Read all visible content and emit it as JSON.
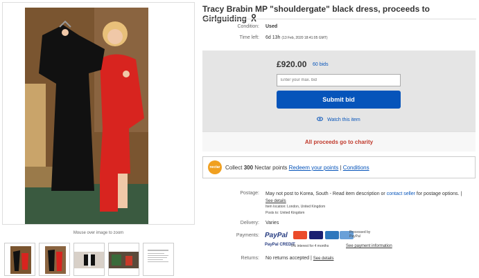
{
  "listing": {
    "title": "Tracy Brabin MP \"shouldergate\" black dress, proceeds to Girlguiding",
    "condition_label": "Condition:",
    "condition_value": "Used",
    "time_left_label": "Time left:",
    "time_left_value": "6d 13h",
    "time_left_detail": "(13 Feb, 2020  18:41:05 GMT)"
  },
  "gallery": {
    "zoom_hint": "Mouse over image to zoom",
    "thumbnail_count": 5
  },
  "bidding": {
    "price": "£920.00",
    "bids": "60 bids",
    "bid_placeholder": "Enter your max. bid",
    "submit_label": "Submit bid",
    "watch_label": "Watch this item",
    "charity_text": "All proceeds go to charity"
  },
  "nectar": {
    "logo": "nectar",
    "collect_prefix": "Collect",
    "points": "300",
    "points_suffix": "Nectar points",
    "redeem_link": "Redeem your points",
    "separator": "|",
    "conditions_link": "Conditions"
  },
  "details": {
    "postage_label": "Postage:",
    "postage_value": "May not post to Korea, South - Read item description or",
    "contact_link": "contact seller",
    "postage_suffix": "for",
    "postage_line2": "postage options.",
    "see_details": "See details",
    "item_location": "Item location:  London, United Kingdom",
    "posts_to": "Posts to:  United Kingdom",
    "delivery_label": "Delivery:",
    "delivery_value": "Varies",
    "payments_label": "Payments:",
    "paypal_label": "PayPal",
    "processed_by": "Processed by PayPal",
    "paypal_credit": "PayPal CREDIT",
    "credit_text": "0% interest for 4 months",
    "see_payment_info": "See payment information",
    "returns_label": "Returns:",
    "returns_value": "No returns accepted",
    "returns_see_details": "See details"
  },
  "colors": {
    "link": "#0654ba",
    "submit_bg": "#0654ba",
    "charity_red": "#c0392b",
    "bid_panel": "#e5e5e5"
  }
}
